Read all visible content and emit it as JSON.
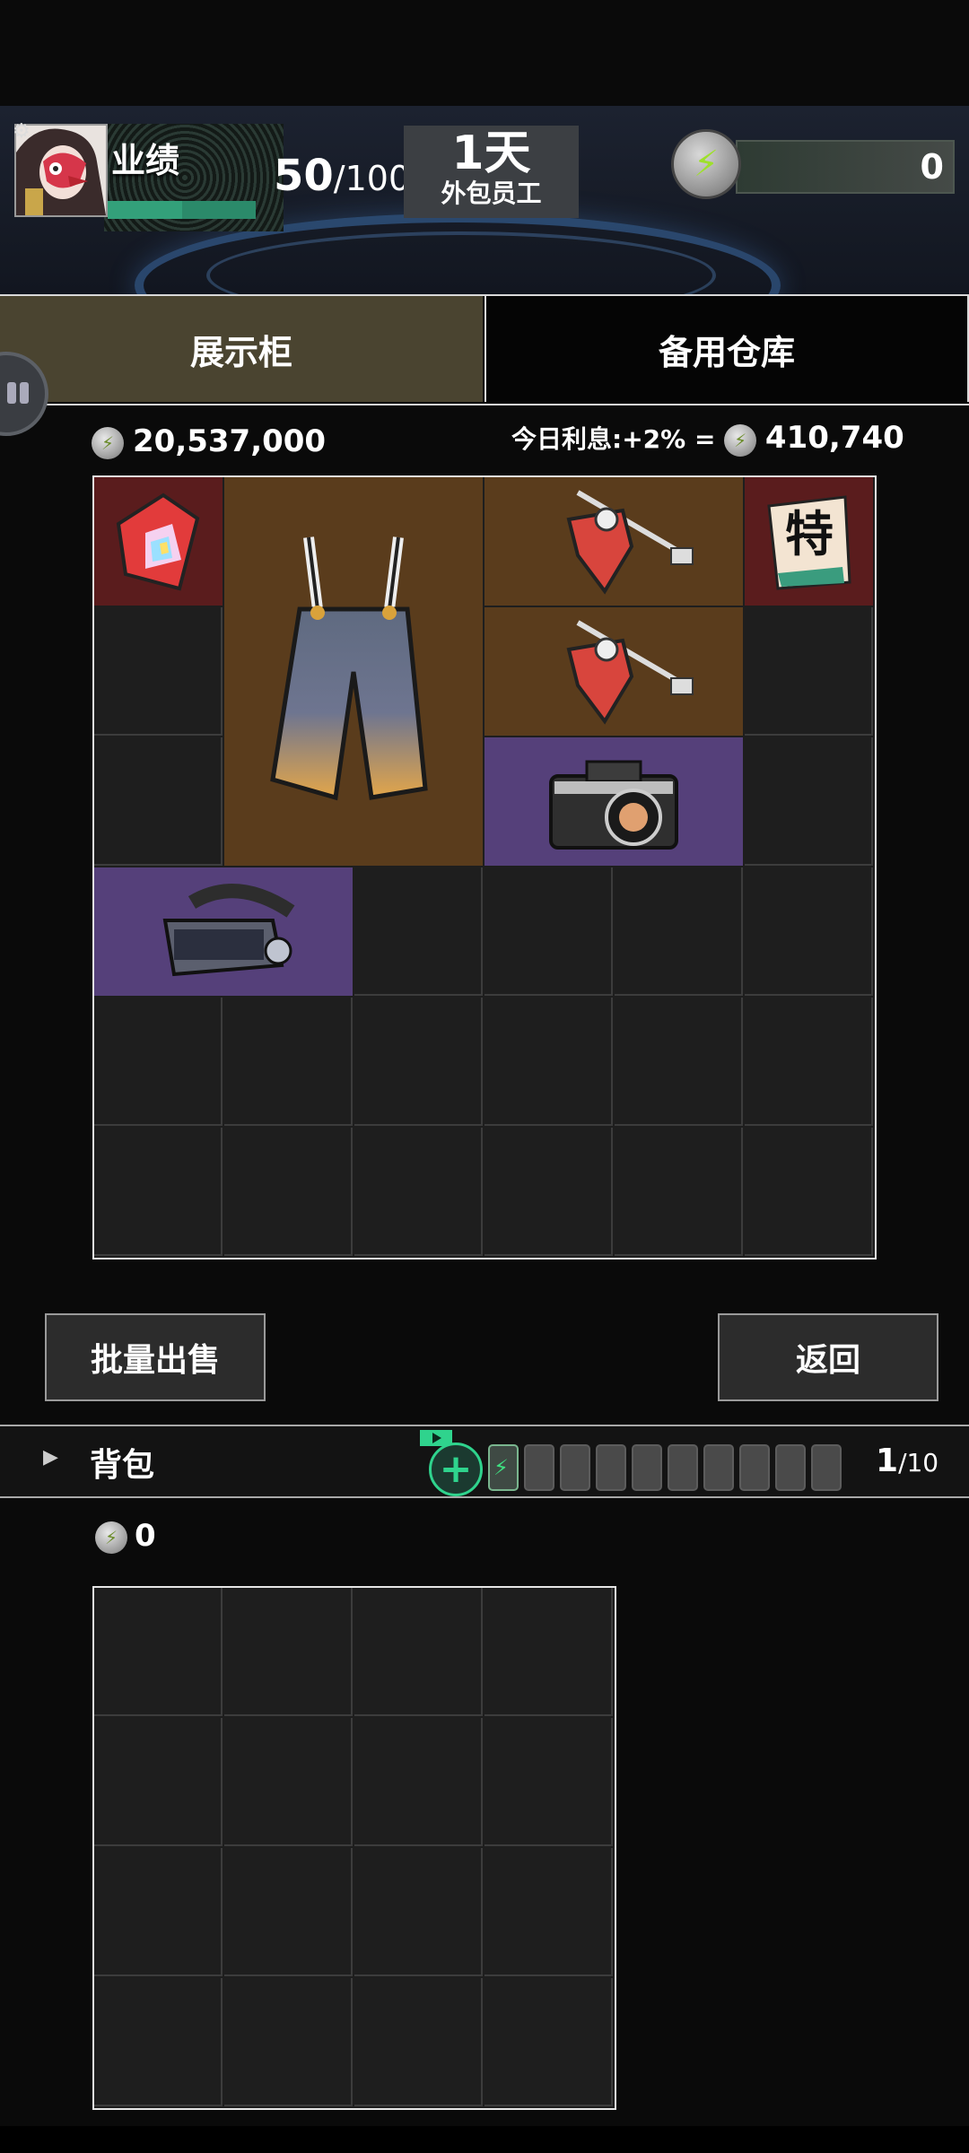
{
  "header": {
    "performance_label": "业绩",
    "performance_current": "50",
    "performance_max": "/100",
    "performance_progress": 0.5,
    "day_count": "1天",
    "rank": "外包员工",
    "energy_value": "0"
  },
  "tabs": {
    "showcase": "展示柜",
    "storage": "备用仓库"
  },
  "showcase": {
    "money": "20,537,000",
    "interest_label": "今日利息:+2% =",
    "interest_value": "410,740",
    "grid": {
      "cols": 6,
      "rows": 6
    },
    "items": [
      {
        "name": "rainbow-crystal",
        "rarity": "red"
      },
      {
        "name": "suspender-pants",
        "rarity": "brown"
      },
      {
        "name": "red-spinning-top",
        "rarity": "brown"
      },
      {
        "name": "special-ticket",
        "rarity": "red",
        "text": "特"
      },
      {
        "name": "red-spinning-top",
        "rarity": "brown"
      },
      {
        "name": "camera",
        "rarity": "purple"
      },
      {
        "name": "vr-headset",
        "rarity": "purple"
      }
    ]
  },
  "buttons": {
    "bulk_sell": "批量出售",
    "back": "返回"
  },
  "backpack": {
    "label": "背包",
    "batteries_current": "1",
    "batteries_max": "/10",
    "money": "0",
    "grid": {
      "cols": 4,
      "rows": 4
    }
  }
}
